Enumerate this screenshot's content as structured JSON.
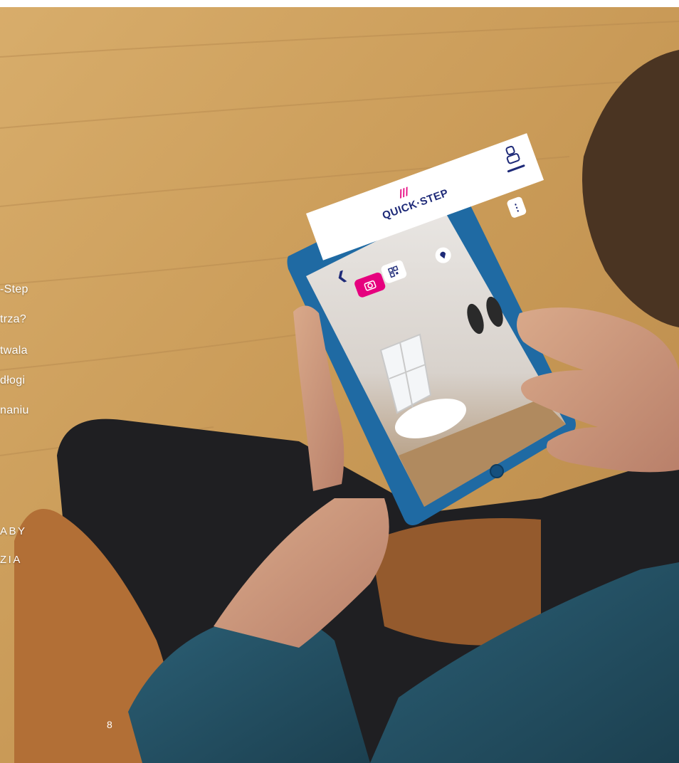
{
  "overlay_text": {
    "line1": "-Step",
    "line2": "trza?",
    "line3": "twala",
    "line4": "dłogi",
    "line5": "naniu",
    "caps1": "ABY",
    "caps2": "ZIA"
  },
  "page_number": "8",
  "tablet_app": {
    "brand_mark": "///",
    "brand_name": "QUICK·STEP",
    "icons": {
      "back": "chevron-left-icon",
      "camera": "camera-icon",
      "qr": "qr-code-icon",
      "pin": "location-pin-icon",
      "menu": "more-vertical-icon",
      "profile": "profile-icon"
    }
  },
  "colors": {
    "brand_pink": "#e6007e",
    "brand_navy": "#1e2a78",
    "tablet_blue": "#1f6aa3",
    "floor_wood": "#c89a5a"
  }
}
